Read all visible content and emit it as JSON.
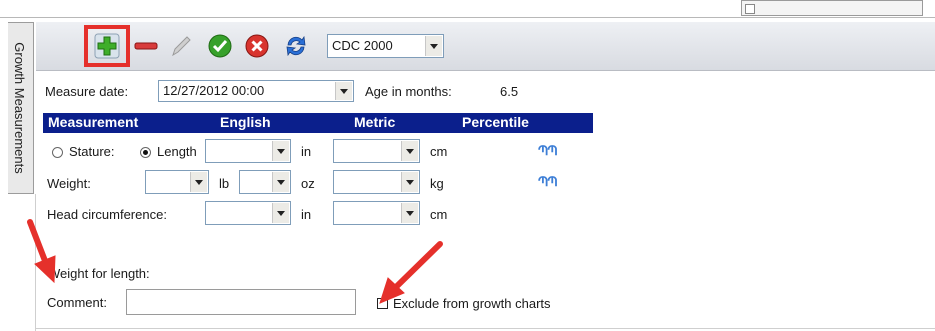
{
  "side_tab": {
    "label": "Growth Measurements"
  },
  "toolbar": {
    "buttons": [
      {
        "name": "add",
        "icon": "plus-icon"
      },
      {
        "name": "remove",
        "icon": "minus-icon"
      },
      {
        "name": "edit",
        "icon": "pencil-icon"
      },
      {
        "name": "accept",
        "icon": "check-icon"
      },
      {
        "name": "cancel",
        "icon": "x-icon"
      },
      {
        "name": "refresh",
        "icon": "refresh-icon"
      }
    ],
    "chart_standard": "CDC 2000"
  },
  "form": {
    "measure_date_label": "Measure date:",
    "measure_date_value": "12/27/2012 00:00",
    "age_label": "Age in months:",
    "age_value": "6.5",
    "columns": {
      "measurement": "Measurement",
      "english": "English",
      "metric": "Metric",
      "percentile": "Percentile"
    },
    "stature_label": "Stature:",
    "length_label": "Length",
    "length_selected": "length",
    "weight_label": "Weight:",
    "head_label": "Head circumference:",
    "units": {
      "in": "in",
      "cm": "cm",
      "lb": "lb",
      "oz": "oz",
      "kg": "kg"
    },
    "percentile_icon": "growth-chart-icon",
    "weight_for_length_label": "Weight for length:",
    "comment_label": "Comment:",
    "comment_value": "",
    "exclude_label": "Exclude from growth charts",
    "exclude_checked": false
  },
  "colors": {
    "header_bg": "#0b1f8c",
    "highlight": "#e5302b",
    "arrow": "#e5302b"
  }
}
